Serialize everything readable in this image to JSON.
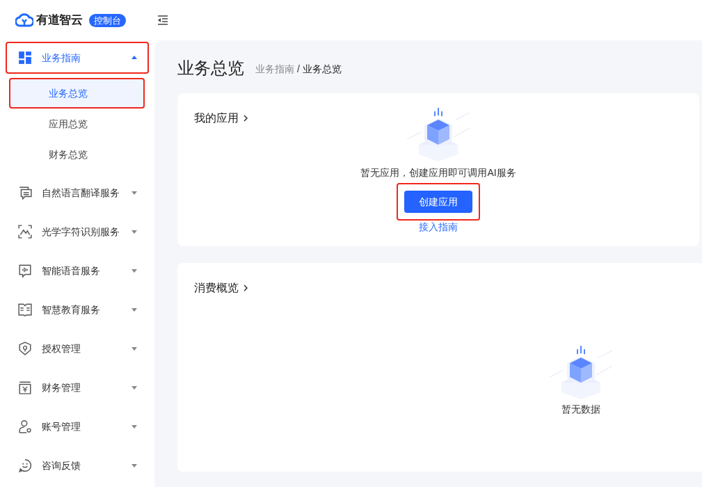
{
  "header": {
    "brand": "有道智云",
    "badge": "控制台"
  },
  "sidebar": {
    "groups": [
      {
        "label": "业务指南",
        "expanded": true,
        "highlighted": true,
        "children": [
          {
            "label": "业务总览",
            "selected": true,
            "highlighted": true
          },
          {
            "label": "应用总览",
            "selected": false,
            "highlighted": false
          },
          {
            "label": "财务总览",
            "selected": false,
            "highlighted": false
          }
        ]
      },
      {
        "label": "自然语言翻译服务",
        "expanded": false,
        "highlighted": false
      },
      {
        "label": "光学字符识别服务",
        "expanded": false,
        "highlighted": false
      },
      {
        "label": "智能语音服务",
        "expanded": false,
        "highlighted": false
      },
      {
        "label": "智慧教育服务",
        "expanded": false,
        "highlighted": false
      },
      {
        "label": "授权管理",
        "expanded": false,
        "highlighted": false
      },
      {
        "label": "财务管理",
        "expanded": false,
        "highlighted": false
      },
      {
        "label": "账号管理",
        "expanded": false,
        "highlighted": false
      },
      {
        "label": "咨询反馈",
        "expanded": false,
        "highlighted": false
      }
    ]
  },
  "page": {
    "title": "业务总览",
    "breadcrumb": [
      "业务指南",
      "业务总览"
    ],
    "breadcrumb_separator": "/"
  },
  "apps_card": {
    "title": "我的应用",
    "empty_text": "暂无应用，创建应用即可调用AI服务",
    "button": {
      "label": "创建应用",
      "highlighted": true
    },
    "link": "接入指南"
  },
  "consumption_card": {
    "title": "消费概览",
    "empty_text": "暂无数据"
  }
}
